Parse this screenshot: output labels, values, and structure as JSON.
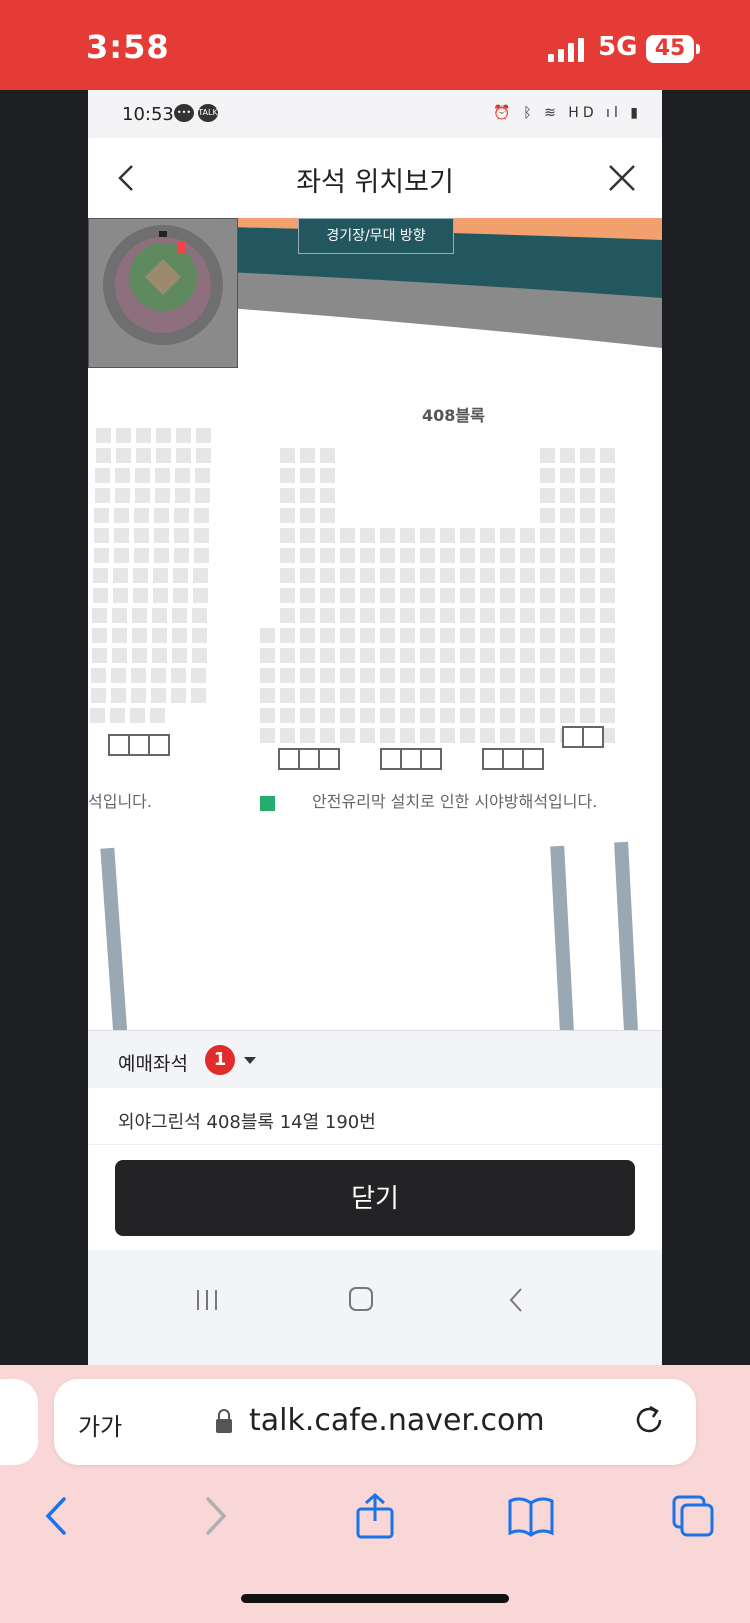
{
  "ios_status": {
    "time": "3:58",
    "network": "5G",
    "battery": "45"
  },
  "android_status": {
    "time": "10:53",
    "talk_badge": "TALK",
    "icons": "⏰ ᛒ ≋ HD ıl ▮"
  },
  "header": {
    "title": "좌석 위치보기"
  },
  "map": {
    "stage_label": "경기장/무대 방향",
    "block_label": "408블록",
    "notice_left": "석입니다.",
    "notice_main": "안전유리막 설치로 인한 시야방해석입니다."
  },
  "selection": {
    "label": "예매좌석",
    "count": "1",
    "seat_detail": "외야그린석 408블록 14열 190번"
  },
  "buttons": {
    "close": "닫기"
  },
  "safari": {
    "text_size": "가가",
    "url": "talk.cafe.naver.com"
  },
  "colors": {
    "ios_bar": "#e43b36",
    "selected_seat": "#26ad6b",
    "badge": "#e22b2b",
    "close_button": "#232326",
    "stage_band": "#22575f"
  }
}
